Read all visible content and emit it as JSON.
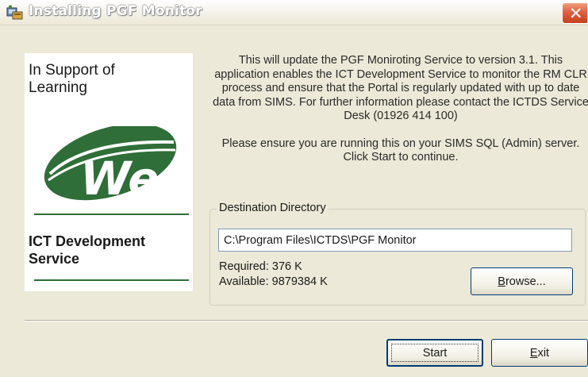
{
  "window": {
    "title": "Installing PGF Monitor",
    "close_glyph": "✕"
  },
  "logo": {
    "top_text_line1": "In Support of",
    "top_text_line2": "Learning",
    "wordmark": "Wes",
    "bottom_text_line1": "ICT Development",
    "bottom_text_line2": "Service",
    "brand_color": "#2f6e38"
  },
  "description": {
    "paragraph1": "This will update the PGF Moniroting Service to version 3.1. This application enables the ICT Development Service to monitor the RM CLR process and ensure that the Portal is regularly updated with up to date data from SIMS. For further information please contact the ICTDS Service Desk (01926 414 100)",
    "paragraph2": "Please ensure you are running this on your SIMS SQL (Admin) server. Click Start to continue."
  },
  "destination": {
    "legend": "Destination Directory",
    "path_value": "C:\\Program Files\\ICTDS\\PGF Monitor",
    "required_text": "Required: 376 K",
    "available_text": "Available: 9879384 K",
    "browse_label_accel": "B",
    "browse_label_rest": "rowse..."
  },
  "buttons": {
    "start_label": "Start",
    "exit_label_accel": "E",
    "exit_label_rest": "xit"
  },
  "icons": {
    "app": "installer-app-icon",
    "close": "close-icon"
  }
}
